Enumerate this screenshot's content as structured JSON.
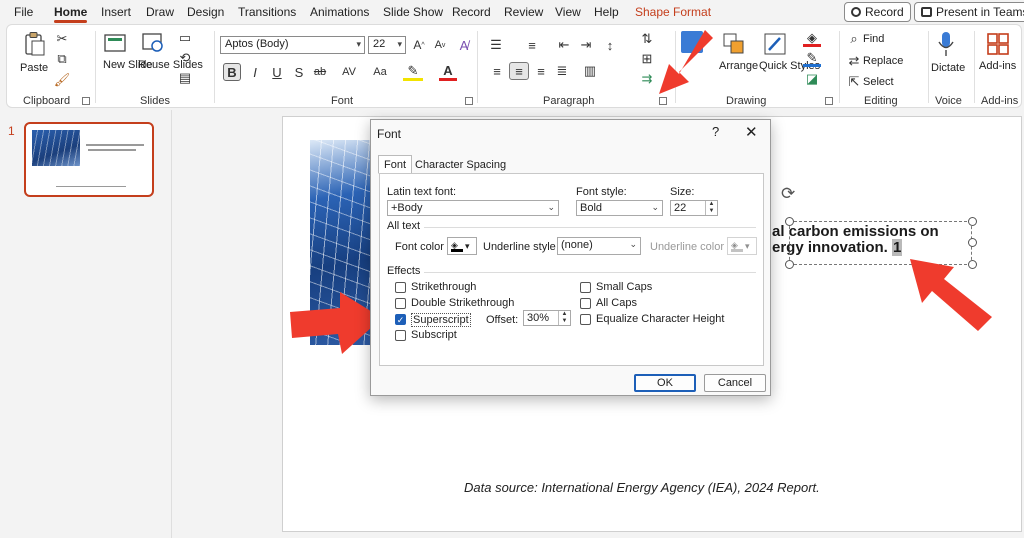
{
  "menu": {
    "tabs": [
      "File",
      "Home",
      "Insert",
      "Draw",
      "Design",
      "Transitions",
      "Animations",
      "Slide Show",
      "Record",
      "Review",
      "View",
      "Help",
      "Shape Format"
    ],
    "record_label": "Record",
    "teams_label": "Present in Teams"
  },
  "ribbon": {
    "clipboard": {
      "paste": "Paste",
      "group": "Clipboard"
    },
    "slides": {
      "new_slide": "New Slide",
      "reuse_slides": "Reuse Slides",
      "group": "Slides"
    },
    "font": {
      "family": "Aptos (Body)",
      "size": "22",
      "bold": "B",
      "italic": "I",
      "underline": "U",
      "shadow": "S",
      "strike": "ab",
      "spacing": "AV",
      "case": "Aa",
      "group": "Font"
    },
    "paragraph": {
      "group": "Paragraph"
    },
    "drawing": {
      "arrange": "Arrange",
      "quick_styles": "Quick Styles",
      "group": "Drawing"
    },
    "editing": {
      "find": "Find",
      "replace": "Replace",
      "select": "Select",
      "group": "Editing"
    },
    "voice": {
      "dictate": "Dictate",
      "group": "Voice"
    },
    "addins": {
      "addins": "Add-ins",
      "group": "Add-ins"
    }
  },
  "thumbnails": {
    "slide_number": "1"
  },
  "slide": {
    "text_line1": "al carbon emissions on",
    "text_line2": "ergy innovation.",
    "selected_char": "1",
    "source": "Data source: International Energy Agency (IEA), 2024 Report."
  },
  "dialog": {
    "title": "Font",
    "help": "?",
    "close": "✕",
    "tabs": [
      "Font",
      "Character Spacing"
    ],
    "latin_font_label": "Latin text font:",
    "latin_font_value": "+Body",
    "font_style_label": "Font style:",
    "font_style_value": "Bold",
    "size_label": "Size:",
    "size_value": "22",
    "all_text_label": "All text",
    "font_color_label": "Font color",
    "underline_style_label": "Underline style",
    "underline_style_value": "(none)",
    "underline_color_label": "Underline color",
    "effects_label": "Effects",
    "effects_left": [
      {
        "label": "Strikethrough",
        "checked": false
      },
      {
        "label": "Double Strikethrough",
        "checked": false
      },
      {
        "label": "Superscript",
        "checked": true
      },
      {
        "label": "Subscript",
        "checked": false
      }
    ],
    "effects_right": [
      {
        "label": "Small Caps",
        "checked": false
      },
      {
        "label": "All Caps",
        "checked": false
      },
      {
        "label": "Equalize Character Height",
        "checked": false
      }
    ],
    "offset_label": "Offset:",
    "offset_value": "30%",
    "ok": "OK",
    "cancel": "Cancel"
  },
  "colors": {
    "accent": "#c43e1c",
    "arrow": "#ef3b2d",
    "check": "#1d5fb8"
  }
}
